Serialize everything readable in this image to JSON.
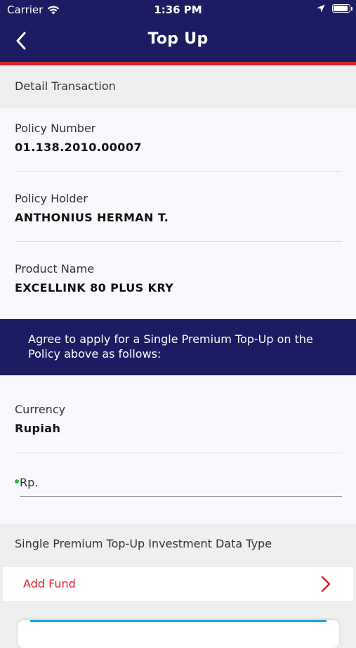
{
  "status_bar": {
    "carrier": "Carrier",
    "time": "1:36 PM",
    "battery_level": 0.9
  },
  "nav": {
    "title": "Top Up"
  },
  "detail": {
    "heading": "Detail Transaction",
    "fields": [
      {
        "label": "Policy Number",
        "value": "01.138.2010.00007"
      },
      {
        "label": "Policy Holder",
        "value": "ANTHONIUS HERMAN T."
      },
      {
        "label": "Product Name",
        "value": "EXCELLINK 80 PLUS KRY"
      }
    ]
  },
  "agreement": {
    "text": "Agree to apply for a Single Premium Top-Up on the Policy  above as follows:"
  },
  "topup": {
    "currency_label": "Currency",
    "currency_value": "Rupiah",
    "amount_placeholder": "Rp.",
    "amount_value": ""
  },
  "investment": {
    "heading": "Single Premium Top-Up Investment Data Type",
    "add_fund_label": "Add Fund"
  },
  "colors": {
    "navy": "#1c1c63",
    "red": "#d8232f",
    "green_dot": "#1fbf4c",
    "blue_accent": "#17a8e0"
  },
  "icons": {
    "back": "chevron-left-icon",
    "wifi": "wifi-icon",
    "location": "location-arrow-icon",
    "battery": "battery-icon",
    "add_fund_chevron": "chevron-right-icon"
  }
}
